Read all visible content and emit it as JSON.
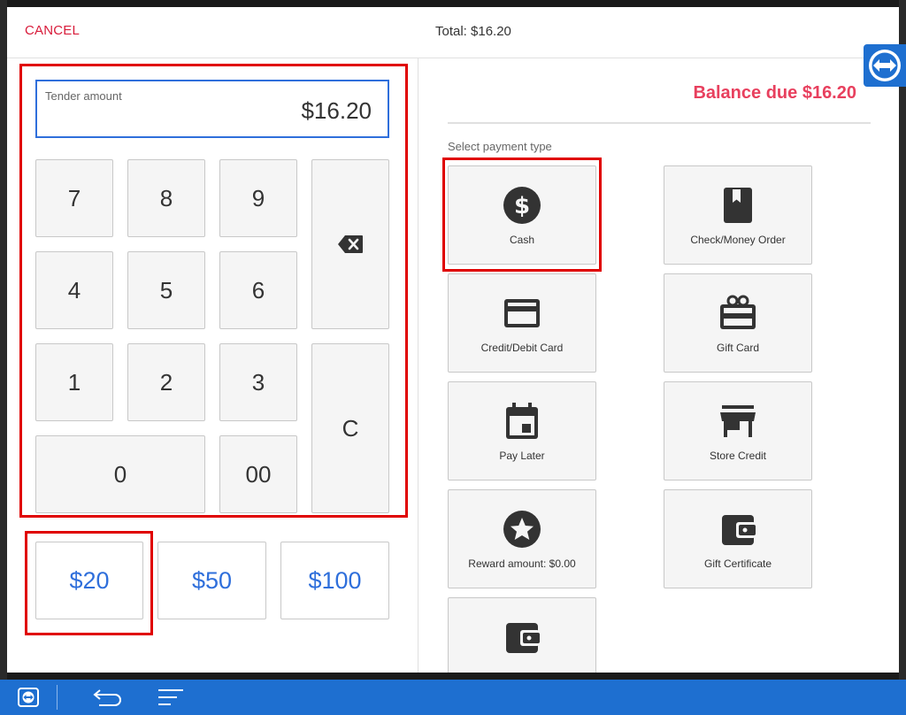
{
  "header": {
    "cancel_label": "CANCEL",
    "total": "Total: $16.20"
  },
  "tender": {
    "label": "Tender amount",
    "value": "$16.20"
  },
  "keypad": {
    "k7": "7",
    "k8": "8",
    "k9": "9",
    "k4": "4",
    "k5": "5",
    "k6": "6",
    "k1": "1",
    "k2": "2",
    "k3": "3",
    "k0": "0",
    "k00": "00",
    "clear": "C",
    "backspace_icon": "backspace-icon"
  },
  "quick_amounts": [
    "$20",
    "$50",
    "$100"
  ],
  "payment": {
    "balance": "Balance due $16.20",
    "select_label": "Select payment type",
    "types": [
      {
        "label": "Cash",
        "icon": "dollar-circle-icon"
      },
      {
        "label": "Check/Money Order",
        "icon": "bookmark-icon"
      },
      {
        "label": "Credit/Debit Card",
        "icon": "credit-card-icon"
      },
      {
        "label": "Gift Card",
        "icon": "gift-card-icon"
      },
      {
        "label": "Pay Later",
        "icon": "calendar-icon"
      },
      {
        "label": "Store Credit",
        "icon": "store-icon"
      },
      {
        "label": "Reward amount: $0.00",
        "icon": "star-circle-icon"
      },
      {
        "label": "Gift Certificate",
        "icon": "wallet-icon"
      },
      {
        "label": "",
        "icon": "wallet-icon"
      }
    ]
  },
  "colors": {
    "accent_blue": "#2f6fdb",
    "cancel_red": "#d81b3a",
    "balance_pink": "#e8405e",
    "highlight_red": "#e00000",
    "taskbar_blue": "#1e6fd0"
  },
  "taskbar": {
    "icons": [
      "teamviewer-icon",
      "back-arrow-icon",
      "menu-lines-icon"
    ]
  }
}
